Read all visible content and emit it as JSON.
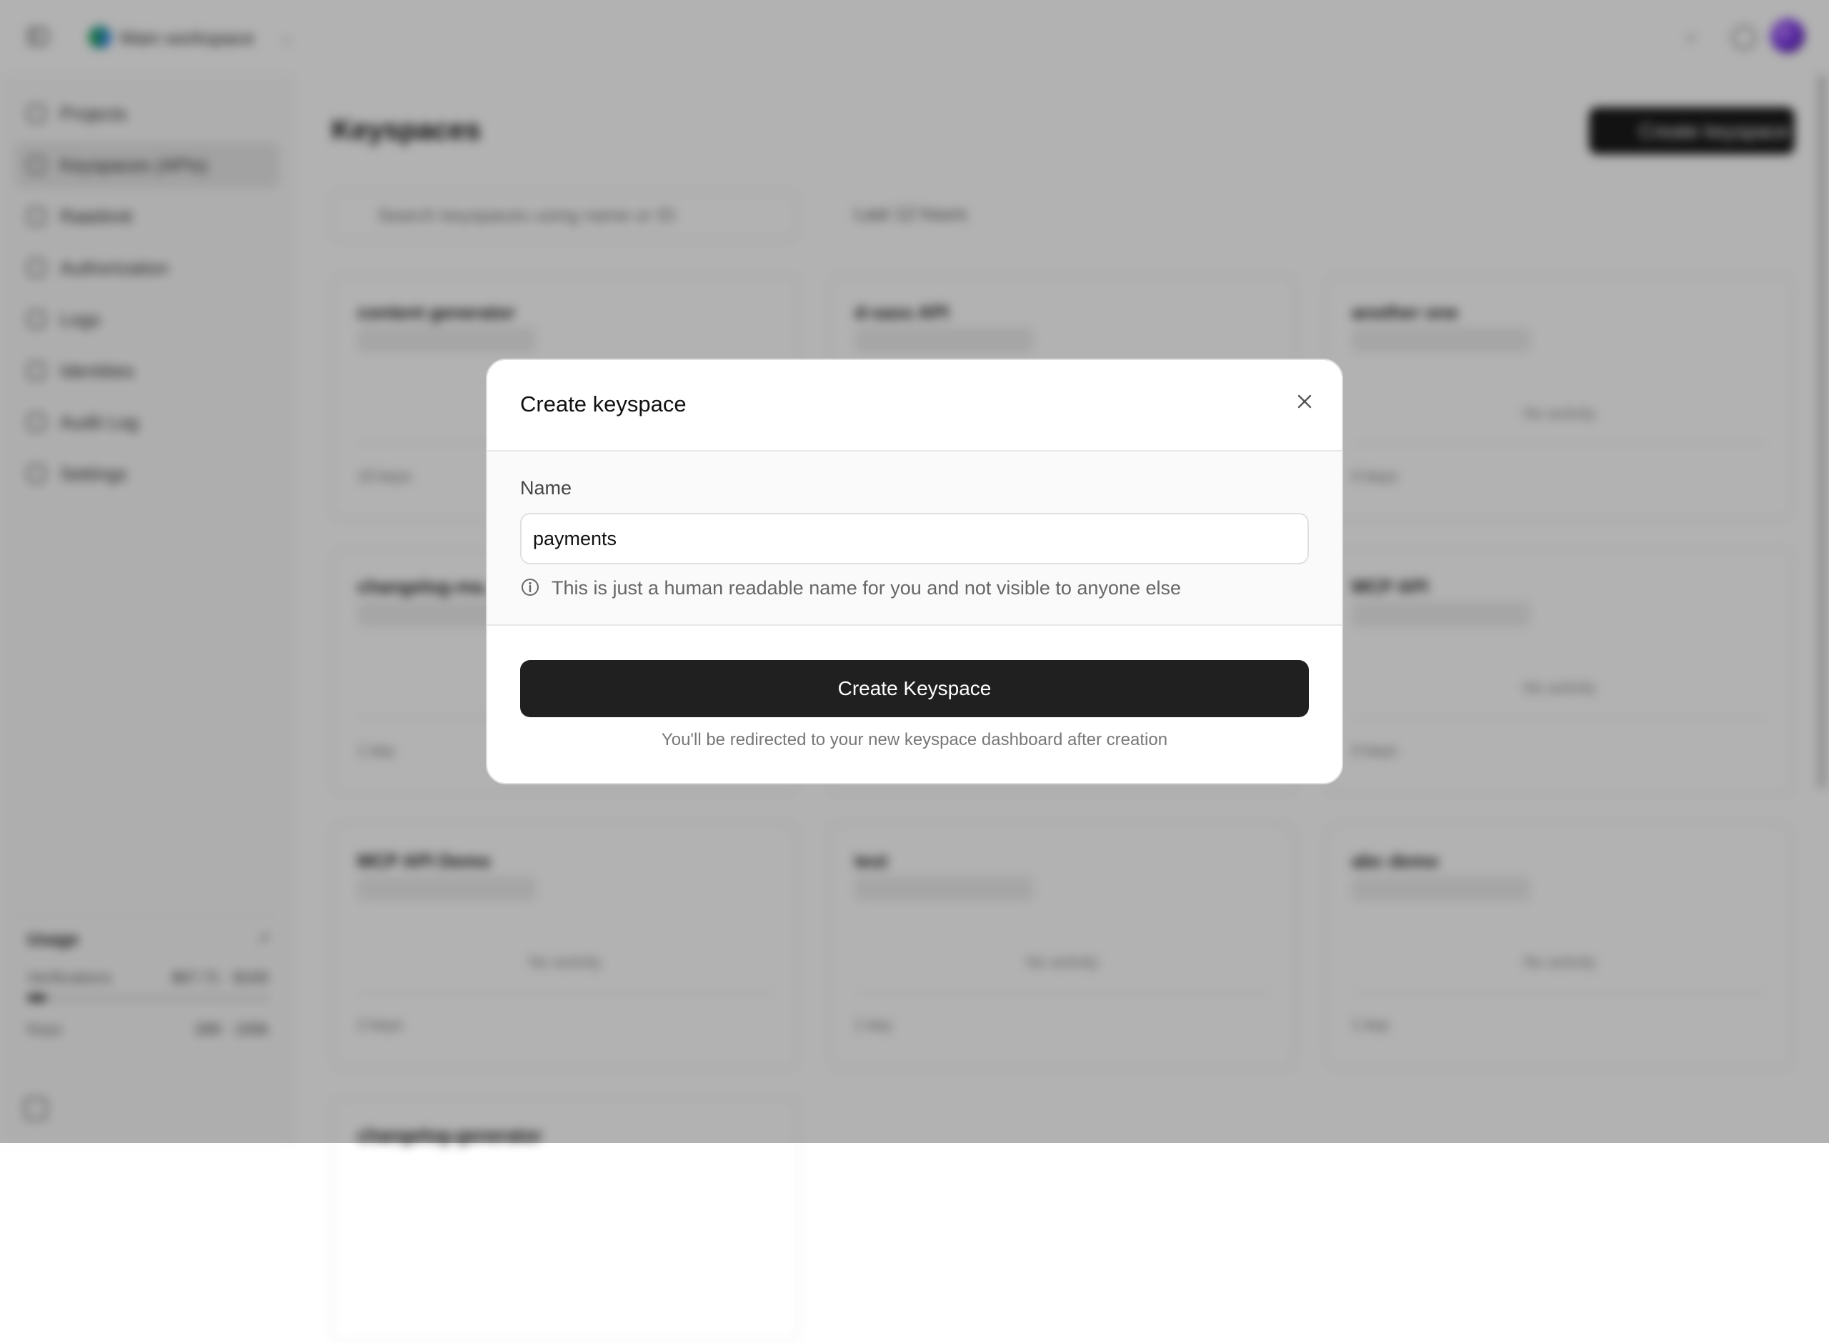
{
  "workspace": {
    "name": "Main workspace"
  },
  "sidebar": {
    "items": [
      {
        "label": "Projects"
      },
      {
        "label": "Keyspaces (APIs)"
      },
      {
        "label": "Ratelimit"
      },
      {
        "label": "Authorization"
      },
      {
        "label": "Logs"
      },
      {
        "label": "Identities"
      },
      {
        "label": "Audit Log"
      },
      {
        "label": "Settings"
      }
    ],
    "usage": {
      "title": "Usage",
      "verifications_label": "Verifications",
      "verifications_value": "$67.71 · $100",
      "keys_label": "Keys",
      "keys_value": "268 · 100k",
      "verifications_fraction": 0.08
    }
  },
  "main": {
    "title": "Keyspaces",
    "create_button": "Create keyspace",
    "search_placeholder": "Search keyspaces using name or ID",
    "time_filter": "Last 12 hours",
    "cards": [
      {
        "name": "content generator",
        "activity": "",
        "keys": "19 keys"
      },
      {
        "name": "d-sass API",
        "activity": "",
        "keys": ""
      },
      {
        "name": "another one",
        "activity": "No activity",
        "keys": "0 keys"
      },
      {
        "name": "changelog-ma...",
        "activity": "",
        "keys": "1 key"
      },
      {
        "name": "",
        "activity": "",
        "keys": ""
      },
      {
        "name": "MCP API",
        "activity": "No activity",
        "keys": "0 keys"
      },
      {
        "name": "MCP API Demo",
        "activity": "No activity",
        "keys": "2 keys"
      },
      {
        "name": "test",
        "activity": "No activity",
        "keys": "1 key"
      },
      {
        "name": "abc demo",
        "activity": "No activity",
        "keys": "1 key"
      },
      {
        "name": "changelog-generator",
        "activity": "",
        "keys": ""
      }
    ]
  },
  "dialog": {
    "title": "Create keyspace",
    "name_label": "Name",
    "name_value": "payments",
    "hint": "This is just a human readable name for you and not visible to anyone else",
    "submit_label": "Create Keyspace",
    "footnote": "You'll be redirected to your new keyspace dashboard after creation"
  }
}
